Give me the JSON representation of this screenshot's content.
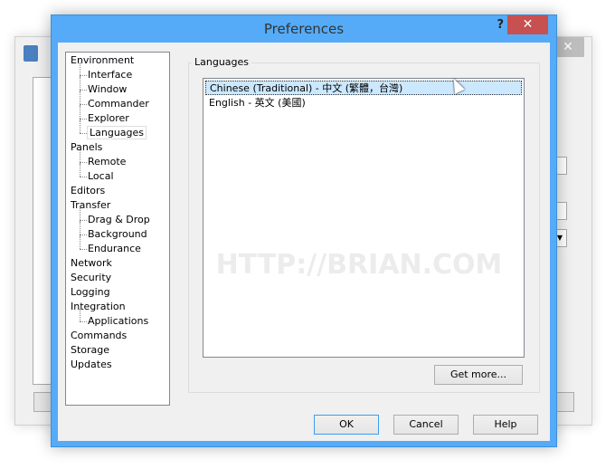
{
  "dialog": {
    "title": "Preferences",
    "help_glyph": "?",
    "close_glyph": "✕"
  },
  "background_window": {
    "close_glyph": "✕"
  },
  "tree": [
    {
      "label": "Environment",
      "level": 0
    },
    {
      "label": "Interface",
      "level": 1
    },
    {
      "label": "Window",
      "level": 1
    },
    {
      "label": "Commander",
      "level": 1
    },
    {
      "label": "Explorer",
      "level": 1
    },
    {
      "label": "Languages",
      "level": 1,
      "selected": true
    },
    {
      "label": "Panels",
      "level": 0
    },
    {
      "label": "Remote",
      "level": 1
    },
    {
      "label": "Local",
      "level": 1
    },
    {
      "label": "Editors",
      "level": 0
    },
    {
      "label": "Transfer",
      "level": 0
    },
    {
      "label": "Drag & Drop",
      "level": 1
    },
    {
      "label": "Background",
      "level": 1
    },
    {
      "label": "Endurance",
      "level": 1
    },
    {
      "label": "Network",
      "level": 0
    },
    {
      "label": "Security",
      "level": 0
    },
    {
      "label": "Logging",
      "level": 0
    },
    {
      "label": "Integration",
      "level": 0
    },
    {
      "label": "Applications",
      "level": 1
    },
    {
      "label": "Commands",
      "level": 0
    },
    {
      "label": "Storage",
      "level": 0
    },
    {
      "label": "Updates",
      "level": 0
    }
  ],
  "languages": {
    "group_label": "Languages",
    "items": [
      {
        "label": "Chinese (Traditional) - 中文 (繁體，台灣)",
        "selected": true
      },
      {
        "label": "English - 英文 (美國)",
        "selected": false
      }
    ],
    "get_more_label": "Get more..."
  },
  "buttons": {
    "ok": "OK",
    "cancel": "Cancel",
    "help": "Help"
  },
  "watermark": "HTTP://BRIAN.COM",
  "colors": {
    "titlebar": "#55abf7",
    "close": "#c75050",
    "selection": "#cce8ff"
  }
}
